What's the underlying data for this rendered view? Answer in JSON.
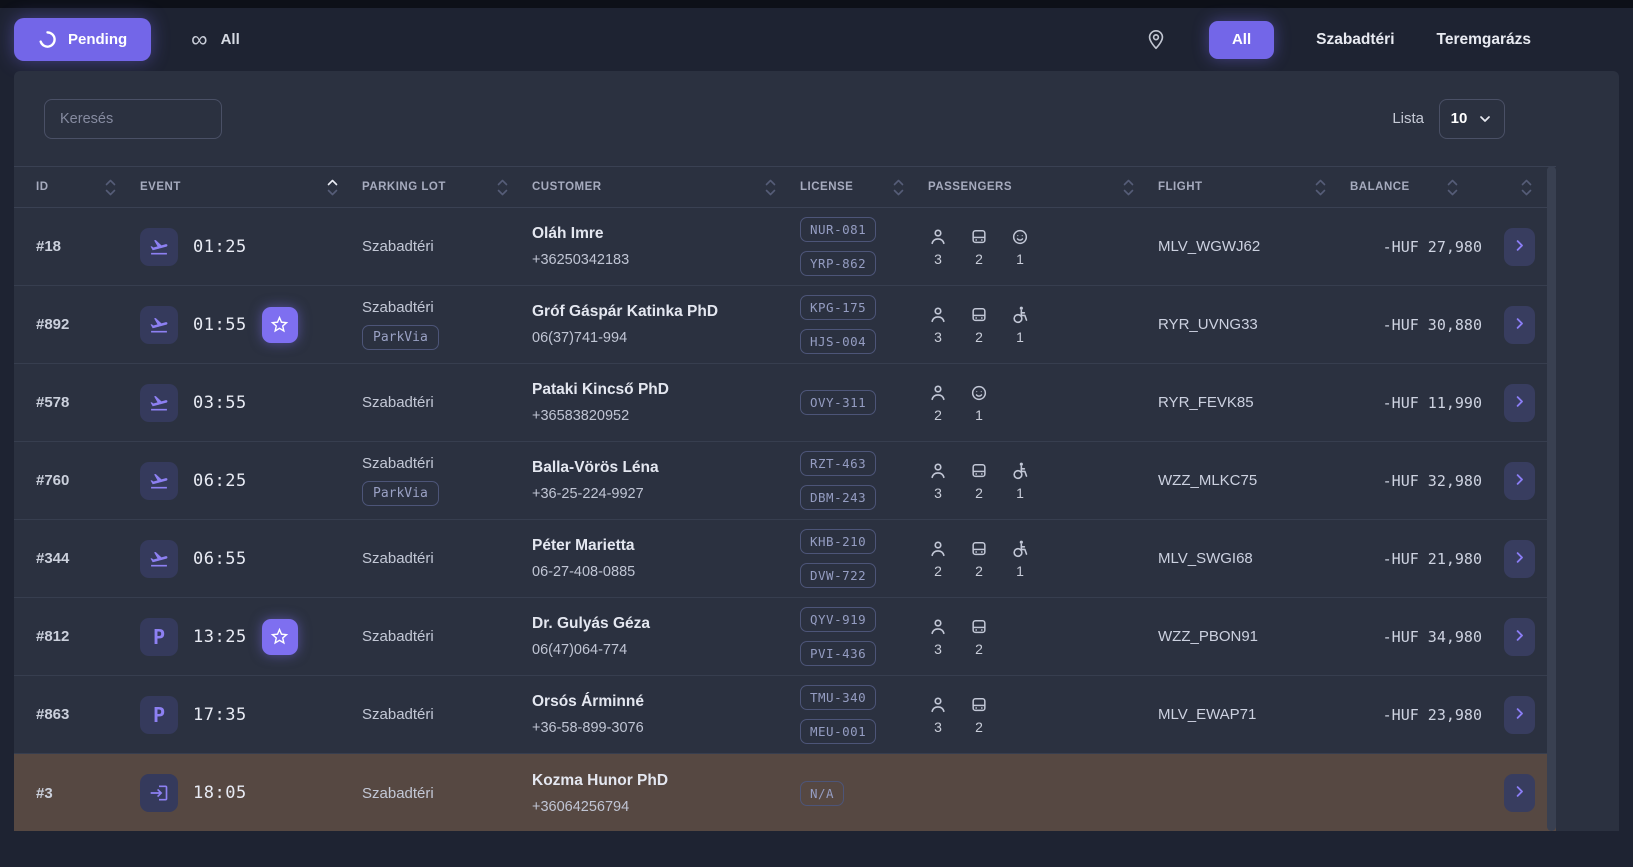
{
  "colors": {
    "accent": "#7366e8",
    "page_bg": "#1e2332",
    "card_bg": "#2b3140",
    "row_highlight": "#564842"
  },
  "topbar": {
    "status_filter": {
      "label": "Pending"
    },
    "scope_filter": {
      "label": "All"
    },
    "location_filter": {
      "tabs": [
        {
          "label": "All",
          "active": true
        },
        {
          "label": "Szabadtéri",
          "active": false
        },
        {
          "label": "Teremgarázs",
          "active": false
        }
      ]
    }
  },
  "toolbar": {
    "search_placeholder": "Keresés",
    "list_label": "Lista",
    "page_size": "10"
  },
  "table": {
    "columns": [
      {
        "label": "ID",
        "sort": "none"
      },
      {
        "label": "EVENT",
        "sort": "asc"
      },
      {
        "label": "PARKING LOT",
        "sort": "none"
      },
      {
        "label": "CUSTOMER",
        "sort": "none"
      },
      {
        "label": "LICENSE",
        "sort": "none"
      },
      {
        "label": "PASSENGERS",
        "sort": "none"
      },
      {
        "label": "FLIGHT",
        "sort": "none"
      },
      {
        "label": "BALANCE",
        "sort": "none"
      }
    ],
    "rows": [
      {
        "id": "#18",
        "event_type": "arrival",
        "time": "01:25",
        "starred": false,
        "lot": "Szabadtéri",
        "lot_badge": "",
        "customer": "Oláh Imre",
        "phone": "+36250342183",
        "plates": [
          "NUR-081",
          "YRP-862"
        ],
        "passengers": [
          {
            "type": "adult",
            "count": 3
          },
          {
            "type": "vehicle",
            "count": 2
          },
          {
            "type": "child",
            "count": 1
          }
        ],
        "flight": "MLV_WGWJ62",
        "balance": "-HUF 27,980",
        "highlighted": false
      },
      {
        "id": "#892",
        "event_type": "arrival",
        "time": "01:55",
        "starred": true,
        "lot": "Szabadtéri",
        "lot_badge": "ParkVia",
        "customer": "Gróf Gáspár Katinka PhD",
        "phone": "06(37)741-994",
        "plates": [
          "KPG-175",
          "HJS-004"
        ],
        "passengers": [
          {
            "type": "adult",
            "count": 3
          },
          {
            "type": "vehicle",
            "count": 2
          },
          {
            "type": "wheelchair",
            "count": 1
          }
        ],
        "flight": "RYR_UVNG33",
        "balance": "-HUF 30,880",
        "highlighted": false
      },
      {
        "id": "#578",
        "event_type": "arrival",
        "time": "03:55",
        "starred": false,
        "lot": "Szabadtéri",
        "lot_badge": "",
        "customer": "Pataki Kincső PhD",
        "phone": "+36583820952",
        "plates": [
          "OVY-311"
        ],
        "passengers": [
          {
            "type": "adult",
            "count": 2
          },
          {
            "type": "child",
            "count": 1
          }
        ],
        "flight": "RYR_FEVK85",
        "balance": "-HUF 11,990",
        "highlighted": false
      },
      {
        "id": "#760",
        "event_type": "arrival",
        "time": "06:25",
        "starred": false,
        "lot": "Szabadtéri",
        "lot_badge": "ParkVia",
        "customer": "Balla-Vörös Léna",
        "phone": "+36-25-224-9927",
        "plates": [
          "RZT-463",
          "DBM-243"
        ],
        "passengers": [
          {
            "type": "adult",
            "count": 3
          },
          {
            "type": "vehicle",
            "count": 2
          },
          {
            "type": "wheelchair",
            "count": 1
          }
        ],
        "flight": "WZZ_MLKC75",
        "balance": "-HUF 32,980",
        "highlighted": false
      },
      {
        "id": "#344",
        "event_type": "arrival",
        "time": "06:55",
        "starred": false,
        "lot": "Szabadtéri",
        "lot_badge": "",
        "customer": "Péter Marietta",
        "phone": "06-27-408-0885",
        "plates": [
          "KHB-210",
          "DVW-722"
        ],
        "passengers": [
          {
            "type": "adult",
            "count": 2
          },
          {
            "type": "vehicle",
            "count": 2
          },
          {
            "type": "wheelchair",
            "count": 1
          }
        ],
        "flight": "MLV_SWGI68",
        "balance": "-HUF 21,980",
        "highlighted": false
      },
      {
        "id": "#812",
        "event_type": "parking",
        "time": "13:25",
        "starred": true,
        "lot": "Szabadtéri",
        "lot_badge": "",
        "customer": "Dr. Gulyás Géza",
        "phone": "06(47)064-774",
        "plates": [
          "QYV-919",
          "PVI-436"
        ],
        "passengers": [
          {
            "type": "adult",
            "count": 3
          },
          {
            "type": "vehicle",
            "count": 2
          }
        ],
        "flight": "WZZ_PBON91",
        "balance": "-HUF 34,980",
        "highlighted": false
      },
      {
        "id": "#863",
        "event_type": "parking",
        "time": "17:35",
        "starred": false,
        "lot": "Szabadtéri",
        "lot_badge": "",
        "customer": "Orsós Árminné",
        "phone": "+36-58-899-3076",
        "plates": [
          "TMU-340",
          "MEU-001"
        ],
        "passengers": [
          {
            "type": "adult",
            "count": 3
          },
          {
            "type": "vehicle",
            "count": 2
          }
        ],
        "flight": "MLV_EWAP71",
        "balance": "-HUF 23,980",
        "highlighted": false
      },
      {
        "id": "#3",
        "event_type": "checkin",
        "time": "18:05",
        "starred": false,
        "lot": "Szabadtéri",
        "lot_badge": "",
        "customer": "Kozma Hunor PhD",
        "phone": "+36064256794",
        "plates": [
          "N/A"
        ],
        "passengers": [],
        "flight": "",
        "balance": "",
        "highlighted": true
      }
    ]
  }
}
